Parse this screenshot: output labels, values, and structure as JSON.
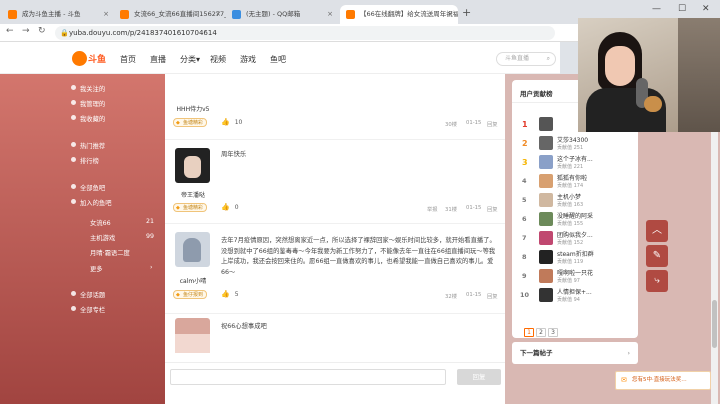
{
  "browser": {
    "tabs": [
      {
        "label": "成为斗鱼主播 - 斗鱼",
        "color": "#ff7a00"
      },
      {
        "label": "女流66_女流66直播间156277_斗鱼",
        "color": "#ff7a00"
      },
      {
        "label": "(无主题) - QQ邮箱",
        "color": "#3b8ee0"
      },
      {
        "label": "【66在线翻牌】给女流送周年祝福",
        "color": "#ff7a00"
      }
    ],
    "url": "yuba.douyu.com/p/241837401610704614"
  },
  "site": {
    "logo_text": "斗鱼",
    "nav": [
      "首页",
      "直播",
      "分类▾",
      "视频",
      "游戏",
      "鱼吧"
    ],
    "search_placeholder": "斗鱼直播"
  },
  "sidebar": {
    "items": [
      {
        "label": "我关注的"
      },
      {
        "label": "我管理的"
      },
      {
        "label": "我收藏的"
      },
      {
        "label": "热门推荐"
      },
      {
        "label": "排行榜"
      },
      {
        "label": "全部鱼吧"
      },
      {
        "label": "加入的鱼吧"
      }
    ],
    "sub_items": [
      {
        "label": "女流66",
        "count": "21"
      },
      {
        "label": "主机游戏",
        "count": "99"
      },
      {
        "label": "月晴·霜语二度",
        "count": ""
      }
    ],
    "more": "更多",
    "bottom": [
      {
        "label": "全部话题"
      },
      {
        "label": "全部专栏"
      }
    ]
  },
  "posts": [
    {
      "user": "HHH侍力v5",
      "badge": "鱼塘精彩",
      "text": "",
      "likes": "10",
      "floor": "30楼",
      "date": "01-15",
      "reply": "回复",
      "avatar_color": "#2a2a2a"
    },
    {
      "user": "帝王潘哒",
      "badge": "鱼塘精彩",
      "text": "周年快乐",
      "likes": "0",
      "report": "举报",
      "floor": "31楼",
      "date": "01-15",
      "reply": "回复",
      "avatar_color": "#222"
    },
    {
      "user": "calm小晴",
      "badge": "鱼仔报到",
      "text": "去年7月疫情原因，突然想离家近一点，所以选择了裸辞回家～娱乐时间比较多，就开始看直播了。没想到就中了66组的鉴毒毒～今年我要为新工作努力了，不能像去年一直往在66组直播间玩～等我上岸成功，我还会按回来住的。愿66组一直做喜欢的事儿，也希望我能一直做自己喜欢的事儿。爱66～",
      "likes": "5",
      "floor": "32楼",
      "date": "01-15",
      "reply": "回复",
      "avatar_color": "#cfd6df"
    },
    {
      "user": "",
      "badge": "",
      "text": "祝66心想事成吧",
      "likes": "",
      "floor": "",
      "date": "",
      "reply": "",
      "avatar_color": "#d9a79c"
    }
  ],
  "reply_button": "回复",
  "ranking": {
    "title": "用户贡献榜",
    "items": [
      {
        "rank": "1",
        "name": "",
        "points": "",
        "color": "#e23b2b",
        "avatar": "#555"
      },
      {
        "rank": "2",
        "name": "艾莎34300",
        "points": "贡献值 251",
        "color": "#f08a24",
        "avatar": "#666"
      },
      {
        "rank": "3",
        "name": "这个子冰有...",
        "points": "贡献值 221",
        "color": "#f5b400",
        "avatar": "#8aa0c8"
      },
      {
        "rank": "4",
        "name": "狐狐有你啦",
        "points": "贡献值 174",
        "color": "#777",
        "avatar": "#d8a070"
      },
      {
        "rank": "5",
        "name": "主机小梦",
        "points": "贡献值 163",
        "color": "#777",
        "avatar": "#d0b8a0"
      },
      {
        "rank": "6",
        "name": "没睡醒的阿采",
        "points": "贡献值 155",
        "color": "#777",
        "avatar": "#6c8a5a"
      },
      {
        "rank": "7",
        "name": "团购似我夕...",
        "points": "贡献值 152",
        "color": "#777",
        "avatar": "#c04870"
      },
      {
        "rank": "8",
        "name": "steam折扣群",
        "points": "贡献值 119",
        "color": "#777",
        "avatar": "#222"
      },
      {
        "rank": "9",
        "name": "嘎啊啦一只花",
        "points": "贡献值 97",
        "color": "#777",
        "avatar": "#c07a5a"
      },
      {
        "rank": "10",
        "name": "人情担保+...",
        "points": "贡献值 94",
        "color": "#777",
        "avatar": "#333"
      }
    ],
    "pages": [
      "1",
      "2",
      "3"
    ]
  },
  "next_post": "下一篇帖子",
  "float_icons": [
    "arrow-up-icon",
    "edit-icon",
    "share-icon"
  ],
  "promo_text": "您有5中·直接玩法奖…"
}
